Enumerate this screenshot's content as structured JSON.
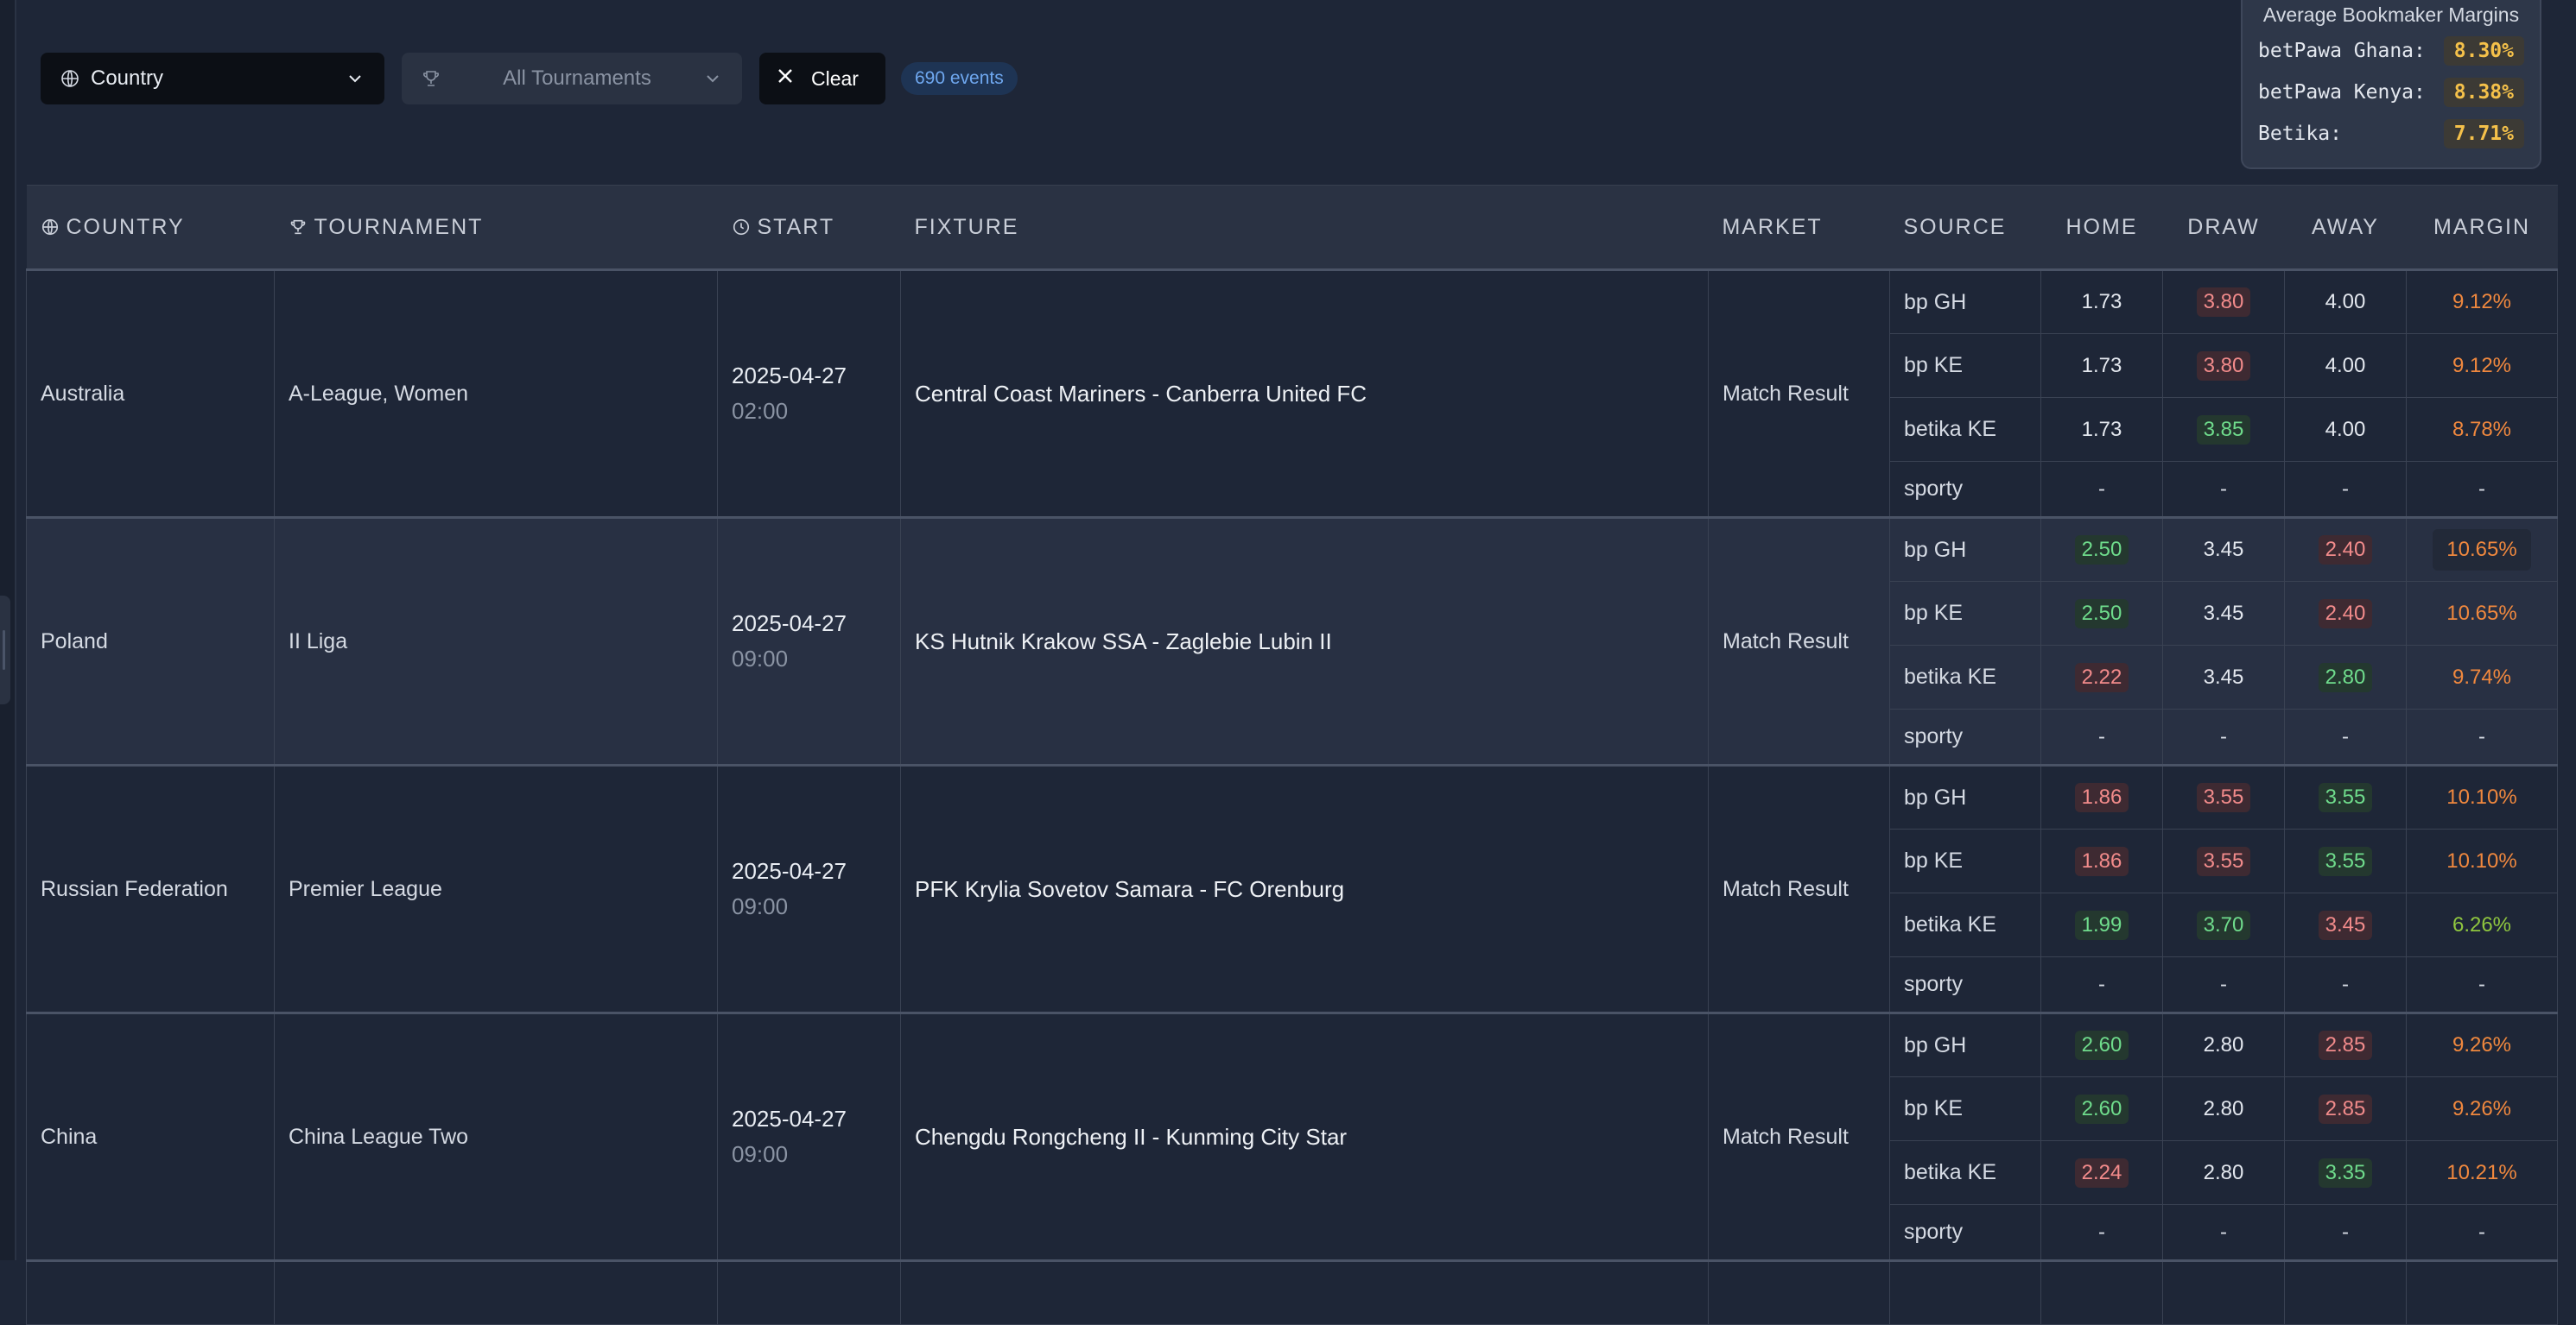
{
  "filters": {
    "country_label": "Country",
    "tournament_label": "All Tournaments",
    "clear_label": "Clear",
    "events_badge": "690 events"
  },
  "margins_panel": {
    "title": "Average Bookmaker Margins",
    "rows": [
      {
        "name": "betPawa Ghana:",
        "value": "8.30%"
      },
      {
        "name": "betPawa Kenya:",
        "value": "8.38%"
      },
      {
        "name": "Betika:",
        "value": "7.71%"
      }
    ]
  },
  "table": {
    "headers": {
      "country": "COUNTRY",
      "tournament": "TOURNAMENT",
      "start": "START",
      "fixture": "FIXTURE",
      "market": "MARKET",
      "source": "SOURCE",
      "home": "HOME",
      "draw": "DRAW",
      "away": "AWAY",
      "margin": "MARGIN"
    },
    "events": [
      {
        "country": "Australia",
        "tournament": "A-League, Women",
        "date": "2025-04-27",
        "time": "02:00",
        "fixture": "Central Coast Mariners - Canberra United FC",
        "market": "Match Result",
        "odds": [
          {
            "source": "bp GH",
            "home": "1.73",
            "draw": "3.80",
            "away": "4.00",
            "margin": "9.12%"
          },
          {
            "source": "bp KE",
            "home": "1.73",
            "draw": "3.80",
            "away": "4.00",
            "margin": "9.12%"
          },
          {
            "source": "betika KE",
            "home": "1.73",
            "draw": "3.85",
            "away": "4.00",
            "margin": "8.78%"
          },
          {
            "source": "sporty",
            "home": "-",
            "draw": "-",
            "away": "-",
            "margin": "-"
          }
        ]
      },
      {
        "country": "Poland",
        "tournament": "II Liga",
        "date": "2025-04-27",
        "time": "09:00",
        "fixture": "KS Hutnik Krakow SSA - Zaglebie Lubin II",
        "market": "Match Result",
        "odds": [
          {
            "source": "bp GH",
            "home": "2.50",
            "draw": "3.45",
            "away": "2.40",
            "margin": "10.65%"
          },
          {
            "source": "bp KE",
            "home": "2.50",
            "draw": "3.45",
            "away": "2.40",
            "margin": "10.65%"
          },
          {
            "source": "betika KE",
            "home": "2.22",
            "draw": "3.45",
            "away": "2.80",
            "margin": "9.74%"
          },
          {
            "source": "sporty",
            "home": "-",
            "draw": "-",
            "away": "-",
            "margin": "-"
          }
        ]
      },
      {
        "country": "Russian Federation",
        "tournament": "Premier League",
        "date": "2025-04-27",
        "time": "09:00",
        "fixture": "PFK Krylia Sovetov Samara - FC Orenburg",
        "market": "Match Result",
        "odds": [
          {
            "source": "bp GH",
            "home": "1.86",
            "draw": "3.55",
            "away": "3.55",
            "margin": "10.10%"
          },
          {
            "source": "bp KE",
            "home": "1.86",
            "draw": "3.55",
            "away": "3.55",
            "margin": "10.10%"
          },
          {
            "source": "betika KE",
            "home": "1.99",
            "draw": "3.70",
            "away": "3.45",
            "margin": "6.26%"
          },
          {
            "source": "sporty",
            "home": "-",
            "draw": "-",
            "away": "-",
            "margin": "-"
          }
        ]
      },
      {
        "country": "China",
        "tournament": "China League Two",
        "date": "2025-04-27",
        "time": "09:00",
        "fixture": "Chengdu Rongcheng II - Kunming City Star",
        "market": "Match Result",
        "odds": [
          {
            "source": "bp GH",
            "home": "2.60",
            "draw": "2.80",
            "away": "2.85",
            "margin": "9.26%"
          },
          {
            "source": "bp KE",
            "home": "2.60",
            "draw": "2.80",
            "away": "2.85",
            "margin": "9.26%"
          },
          {
            "source": "betika KE",
            "home": "2.24",
            "draw": "2.80",
            "away": "3.35",
            "margin": "10.21%"
          },
          {
            "source": "sporty",
            "home": "-",
            "draw": "-",
            "away": "-",
            "margin": "-"
          }
        ]
      }
    ]
  },
  "colors": {
    "better_odds": "#6fdc8c",
    "worse_odds": "#f28b8b",
    "high_margin": "#f0883e",
    "low_margin": "#8fc63f"
  }
}
